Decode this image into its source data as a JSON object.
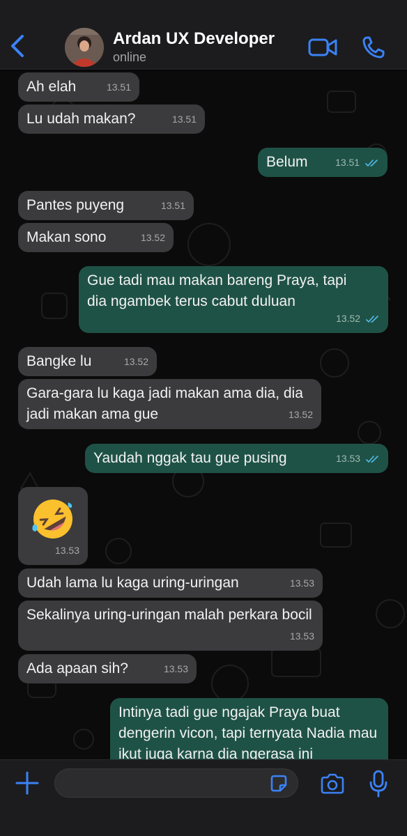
{
  "header": {
    "contact_name": "Ardan UX Developer",
    "status": "online",
    "back_icon": "chevron-left-icon",
    "video_icon": "video-camera-icon",
    "call_icon": "phone-icon"
  },
  "colors": {
    "accent": "#3b82f6",
    "incoming_bubble": "#3b3b3d",
    "outgoing_bubble": "#1f5246",
    "read_ticks": "#53bdeb"
  },
  "messages": [
    {
      "dir": "in",
      "text": "Ah elah",
      "time": "13.51"
    },
    {
      "dir": "in",
      "text": "Lu udah makan?",
      "time": "13.51"
    },
    {
      "dir": "out",
      "text": "Belum",
      "time": "13.51",
      "read": true
    },
    {
      "dir": "in",
      "text": "Pantes puyeng",
      "time": "13.51"
    },
    {
      "dir": "in",
      "text": "Makan sono",
      "time": "13.52"
    },
    {
      "dir": "out",
      "text": "Gue tadi mau makan bareng Praya, tapi dia ngambek terus cabut duluan",
      "time": "13.52",
      "read": true
    },
    {
      "dir": "in",
      "text": "Bangke lu",
      "time": "13.52"
    },
    {
      "dir": "in",
      "text": "Gara-gara lu kaga jadi makan ama dia, dia jadi makan ama gue",
      "time": "13.52"
    },
    {
      "dir": "out",
      "text": "Yaudah nggak tau gue pusing",
      "time": "13.53",
      "read": true
    },
    {
      "dir": "in",
      "emoji": "rolling-on-floor-laughing",
      "time": "13.53"
    },
    {
      "dir": "in",
      "text": "Udah lama lu kaga uring-uringan",
      "time": "13.53"
    },
    {
      "dir": "in",
      "text": "Sekalinya uring-uringan malah perkara bocil",
      "time": "13.53"
    },
    {
      "dir": "in",
      "text": "Ada apaan sih?",
      "time": "13.53"
    },
    {
      "dir": "out",
      "text": "Intinya tadi gue ngajak Praya buat dengerin vicon, tapi ternyata Nadia mau ikut juga karna dia ngerasa ini",
      "time": ""
    }
  ],
  "composer": {
    "input_value": "",
    "plus_icon": "plus-icon",
    "sticker_icon": "sticker-icon",
    "camera_icon": "camera-icon",
    "mic_icon": "microphone-icon"
  }
}
